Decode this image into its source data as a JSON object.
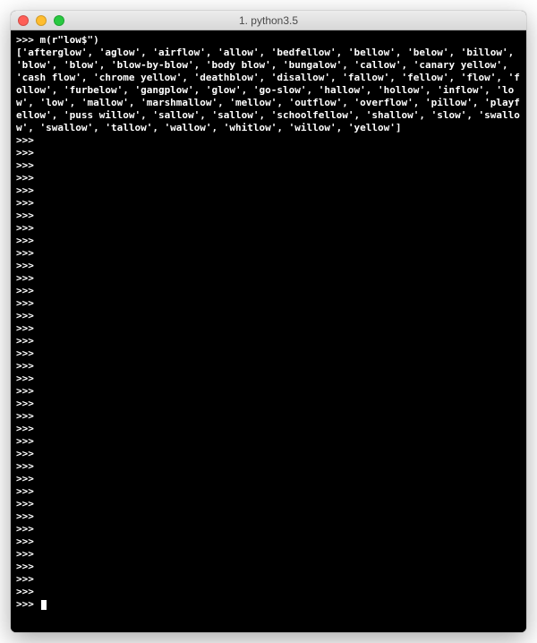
{
  "window": {
    "title": "1. python3.5"
  },
  "terminal": {
    "prompt": ">>> ",
    "input_line": ">>> m(r\"low$\")",
    "output": "['afterglow', 'aglow', 'airflow', 'allow', 'bedfellow', 'bellow', 'below', 'billow', 'blow', 'blow', 'blow-by-blow', 'body blow', 'bungalow', 'callow', 'canary yellow', 'cash flow', 'chrome yellow', 'deathblow', 'disallow', 'fallow', 'fellow', 'flow', 'follow', 'furbelow', 'gangplow', 'glow', 'go-slow', 'hallow', 'hollow', 'inflow', 'low', 'low', 'mallow', 'marshmallow', 'mellow', 'outflow', 'overflow', 'pillow', 'playfellow', 'puss willow', 'sallow', 'sallow', 'schoolfellow', 'shallow', 'slow', 'swallow', 'swallow', 'tallow', 'wallow', 'whitlow', 'willow', 'yellow']",
    "empty_prompt_count": 37
  },
  "traffic_lights": {
    "close": "red",
    "minimize": "yellow",
    "zoom": "green"
  }
}
